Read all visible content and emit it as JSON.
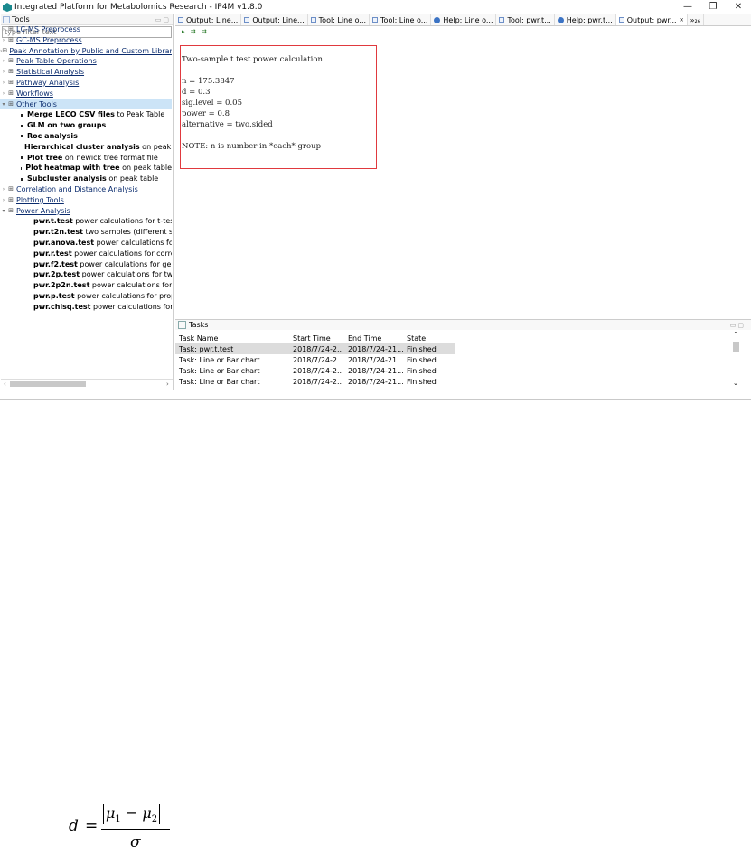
{
  "window": {
    "title": "Integrated Platform for Metabolomics Research - IP4M v1.8.0",
    "controls": [
      "—",
      "❐",
      "✕"
    ]
  },
  "left_panel": {
    "title": "Tools",
    "filter_placeholder": "type filter text",
    "tree": [
      {
        "label": "LC-MS Preprocess"
      },
      {
        "label": "GC-MS Preprocess"
      },
      {
        "label": "Peak Annotation by Public and Custom Librari"
      },
      {
        "label": "Peak Table Operations"
      },
      {
        "label": "Statistical Analysis"
      },
      {
        "label": "Pathway Analysis"
      },
      {
        "label": "Workflows"
      },
      {
        "label": "Other Tools",
        "children": [
          {
            "name": "Merge LECO CSV files",
            "desc": " to Peak Table"
          },
          {
            "name": "GLM on two groups",
            "desc": ""
          },
          {
            "name": "Roc analysis",
            "desc": ""
          },
          {
            "name": "Hierarchical cluster analysis",
            "desc": " on peak table"
          },
          {
            "name": "Plot tree",
            "desc": " on newick tree format file"
          },
          {
            "name": "Plot heatmap with tree",
            "desc": " on peak table"
          },
          {
            "name": "Subcluster analysis",
            "desc": " on peak table"
          }
        ]
      },
      {
        "label": "Correlation and Distance Analysis"
      },
      {
        "label": "Plotting Tools"
      },
      {
        "label": "Power Analysis",
        "children": [
          {
            "name": "pwr.t.test",
            "desc": " power calculations for t-tests o"
          },
          {
            "name": "pwr.t2n.test",
            "desc": " two samples (different sizes)"
          },
          {
            "name": "pwr.anova.test",
            "desc": " power calculations for bal"
          },
          {
            "name": "pwr.r.test",
            "desc": " power calculations for correlati"
          },
          {
            "name": "pwr.f2.test",
            "desc": " power calculations for genera"
          },
          {
            "name": "pwr.2p.test",
            "desc": " power calculations for two pr"
          },
          {
            "name": "pwr.2p2n.test",
            "desc": " power calculations for two"
          },
          {
            "name": "pwr.p.test",
            "desc": " power calculations for proport"
          },
          {
            "name": "pwr.chisq.test",
            "desc": " power calculations for chi-"
          }
        ]
      }
    ]
  },
  "tabs": [
    {
      "label": "Output: Line...",
      "icon": "output"
    },
    {
      "label": "Output: Line...",
      "icon": "output"
    },
    {
      "label": "Tool: Line o...",
      "icon": "tool"
    },
    {
      "label": "Tool: Line o...",
      "icon": "tool"
    },
    {
      "label": "Help: Line o...",
      "icon": "help"
    },
    {
      "label": "Tool: pwr.t...",
      "icon": "tool"
    },
    {
      "label": "Help: pwr.t...",
      "icon": "help"
    },
    {
      "label": "Output: pwr...",
      "icon": "output",
      "active": true
    },
    {
      "label": "»₂₆",
      "icon": "overflow"
    }
  ],
  "output": {
    "lines": [
      "Two-sample t test power calculation",
      "n = 175.3847",
      "d = 0.3",
      "sig.level = 0.05",
      "power = 0.8",
      "alternative = two.sided",
      "NOTE: n is number in *each* group"
    ]
  },
  "tasks": {
    "title": "Tasks",
    "columns": [
      "Task Name",
      "Start Time",
      "End Time",
      "State"
    ],
    "rows": [
      [
        "Task: pwr.t.test",
        "2018/7/24-2...",
        "2018/7/24-21...",
        "Finished"
      ],
      [
        "Task: Line or Bar chart",
        "2018/7/24-2...",
        "2018/7/24-21...",
        "Finished"
      ],
      [
        "Task: Line or Bar chart",
        "2018/7/24-2...",
        "2018/7/24-21...",
        "Finished"
      ],
      [
        "Task: Line or Bar chart",
        "2018/7/24-2...",
        "2018/7/24-21...",
        "Finished"
      ]
    ]
  },
  "formula": {
    "lhs": "d",
    "eq": "=",
    "mu1": "μ",
    "sub1": "1",
    "minus": "−",
    "mu2": "μ",
    "sub2": "2",
    "sigma": "σ"
  }
}
